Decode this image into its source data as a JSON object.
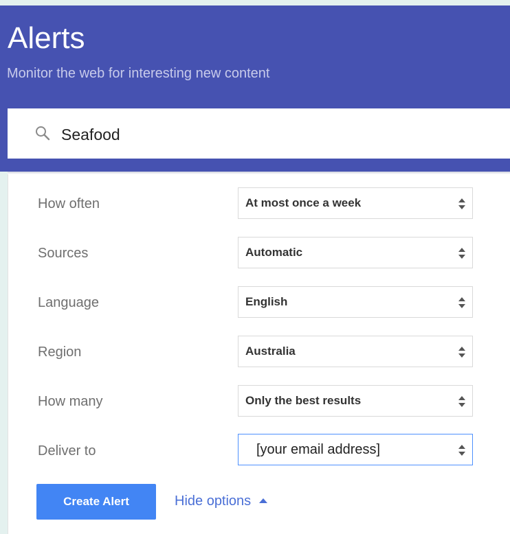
{
  "header": {
    "title": "Alerts",
    "subtitle": "Monitor the web for interesting new content"
  },
  "search": {
    "icon": "search-icon",
    "value": "Seafood"
  },
  "options": [
    {
      "label": "How often",
      "value": "At most once a week"
    },
    {
      "label": "Sources",
      "value": "Automatic"
    },
    {
      "label": "Language",
      "value": "English"
    },
    {
      "label": "Region",
      "value": "Australia"
    },
    {
      "label": "How many",
      "value": "Only the best results"
    },
    {
      "label": "Deliver to",
      "value": "[your email address]"
    }
  ],
  "actions": {
    "create_label": "Create Alert",
    "hide_label": "Hide options"
  },
  "colors": {
    "header_bg": "#4652b1",
    "primary_button": "#4285f4",
    "link": "#4a6fd6",
    "focus_border": "#4d90fe"
  }
}
